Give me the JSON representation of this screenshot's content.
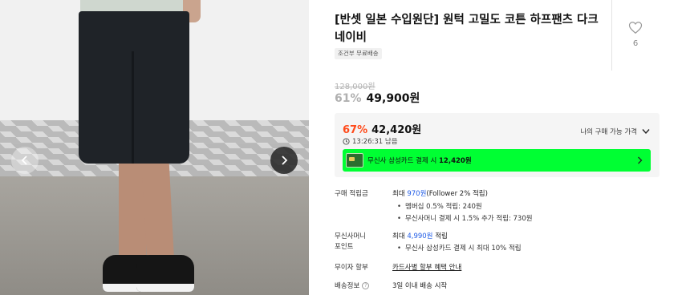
{
  "product": {
    "title": "[반셋 일본 수입원단] 원턱 고밀도 코튼 하프팬츠 다크네이비",
    "shipping_tag": "조건부 무료배송",
    "like_count": "6",
    "original_price": "128,000원",
    "discount_rate": "61%",
    "sale_price": "49,900원"
  },
  "my_price": {
    "discount_rate": "67%",
    "price": "42,420원",
    "timer": "13:26:31 남음",
    "label": "나의 구매 가능 가격",
    "card_banner": {
      "prefix": "무신사 삼성카드 결제 시 ",
      "amount": "12,420원"
    }
  },
  "details": {
    "points": {
      "label": "구매 적립금",
      "prefix": "최대 ",
      "amount": "970원",
      "suffix": "(Follower 2% 적립)",
      "bullets": [
        "멤버십 0.5% 적립: 240원",
        "무신사머니 결제 시 1.5% 추가 적립: 730원"
      ]
    },
    "money": {
      "label_line1": "무신사머니",
      "label_line2": "포인트",
      "prefix": "최대 ",
      "amount": "4,990원",
      "suffix": " 적립",
      "bullets": [
        "무신사 삼성카드 결제 시 최대 10% 적립"
      ]
    },
    "installment": {
      "label": "무이자 할부",
      "value": "카드사별 할부 혜택 안내"
    },
    "delivery": {
      "label": "배송정보",
      "help": "?",
      "value": "3일 이내 배송 시작"
    }
  },
  "colors": {
    "accent_discount": "#ff4a1a",
    "point_blue": "#1f5be6",
    "card_banner_bg": "#00ff33"
  },
  "icons": {
    "prev": "chevron-left-icon",
    "next": "chevron-right-icon",
    "like": "heart-icon",
    "timer": "clock-icon",
    "expand": "chevron-down-icon"
  }
}
